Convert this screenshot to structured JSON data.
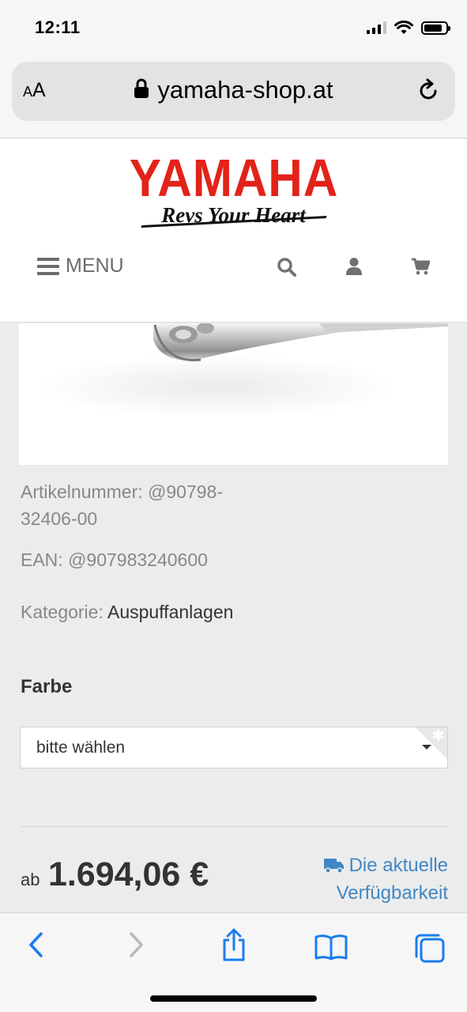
{
  "status_bar": {
    "time": "12:11",
    "signal_bars_active": 3,
    "signal_bars_total": 4,
    "battery_level": 0.85
  },
  "browser": {
    "text_size_label": "AA",
    "url": "yamaha-shop.at",
    "icons": [
      "lock-icon",
      "reload-icon"
    ]
  },
  "site": {
    "logo": "YAMAHA",
    "tagline": "Revs Your Heart",
    "menu_label": "MENU",
    "header_icons": [
      "search-icon",
      "user-icon",
      "cart-icon"
    ],
    "brand_color": "#e2231a"
  },
  "product": {
    "article_label": "Artikelnummer:",
    "article_line1": "@90798-",
    "article_line2": "32406-00",
    "ean_label": "EAN:",
    "ean_value": "@907983240600",
    "category_label": "Kategorie:",
    "category_value": "Auspuffanlagen",
    "color_heading": "Farbe",
    "color_select_value": "bitte wählen",
    "price_prefix": "ab",
    "price": "1.694,06 €",
    "availability_line1": "Die aktuelle",
    "availability_line2": "Verfügbarkeit",
    "link_color": "#3f88c5"
  },
  "toolbar": {
    "items": [
      "back-icon",
      "forward-icon",
      "share-icon",
      "bookmarks-icon",
      "tabs-icon"
    ],
    "accent_color": "#1a7cf0"
  }
}
